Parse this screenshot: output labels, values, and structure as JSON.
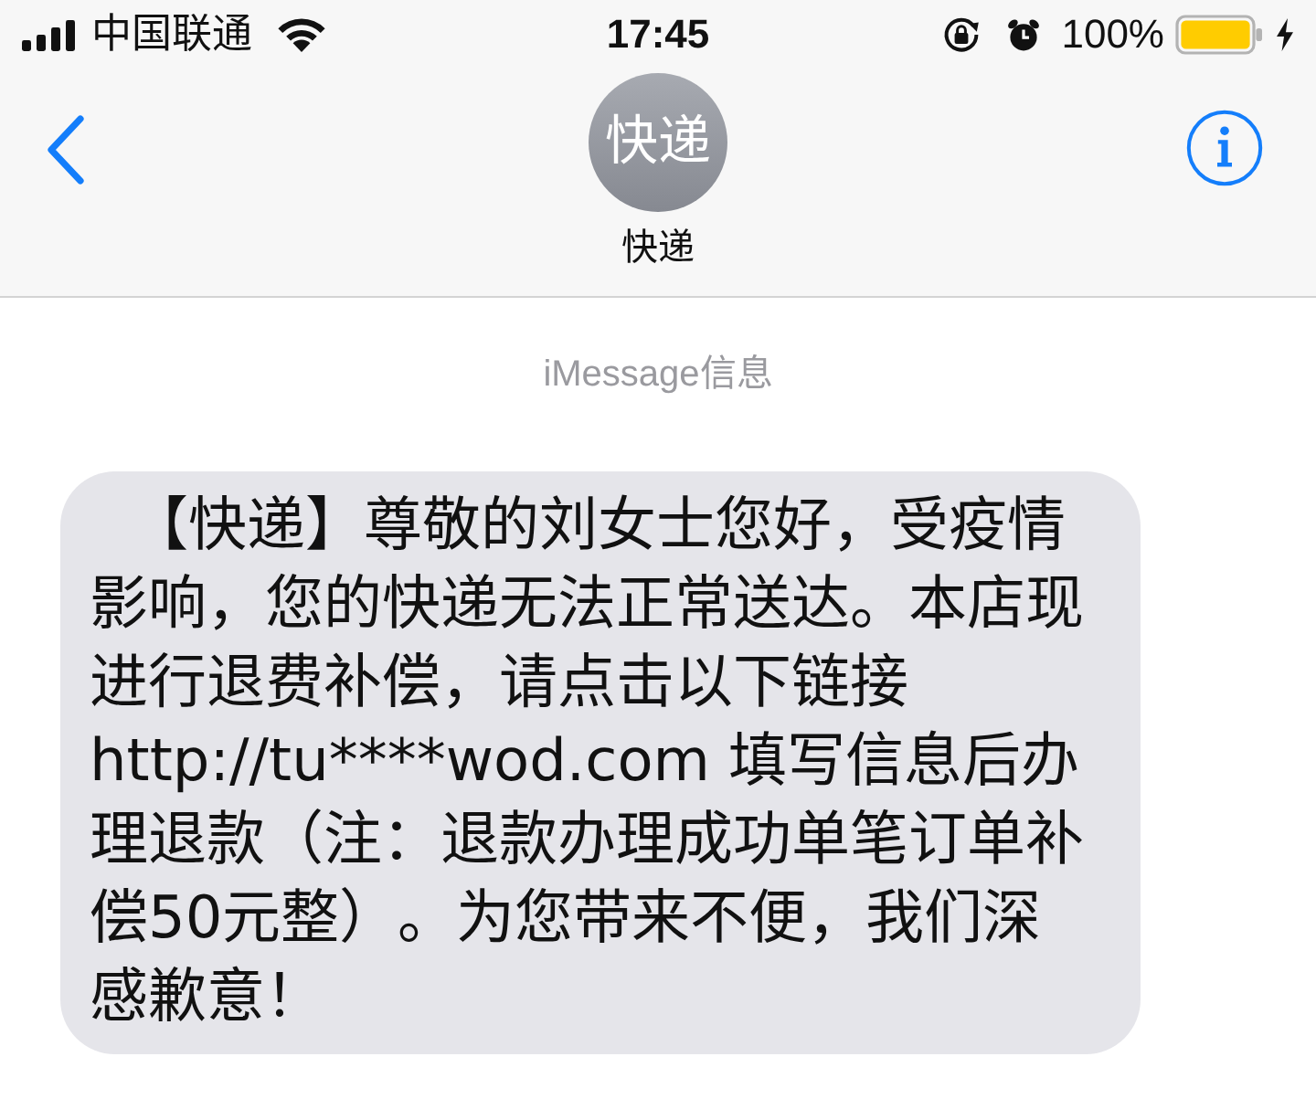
{
  "status_bar": {
    "carrier": "中国联通",
    "time": "17:45",
    "battery_text": "100%"
  },
  "nav_bar": {
    "avatar_text": "快递",
    "contact_name": "快递"
  },
  "conversation": {
    "service_label": "iMessage信息",
    "messages": [
      {
        "kind": "received",
        "text": "【快递】尊敬的刘女士您好，受疫情影响，您的快递无法正常送达。本店现进行退费补偿，请点击以下链接http://tu****wod.com 填写信息后办理退款（注：退款办理成功单笔订单补偿50元整）。为您带来不便，我们深感歉意！"
      }
    ]
  }
}
